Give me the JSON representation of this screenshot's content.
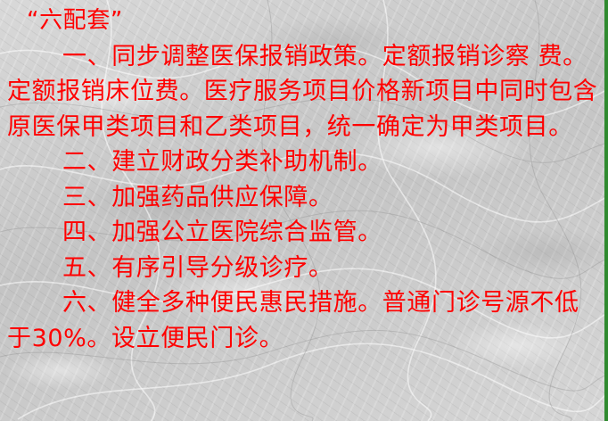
{
  "slide": {
    "title": "“六配套”",
    "paragraphs": [
      {
        "id": "item-1",
        "text": "一、同步调整医保报销政策。定额报销诊察 费。定额报销床位费。医疗服务项目价格新项目中同时包含原医保甲类项目和乙类项目，统一确定为甲类项目。"
      },
      {
        "id": "item-2",
        "text": "二、建立财政分类补助机制。"
      },
      {
        "id": "item-3",
        "text": "三、加强药品供应保障。"
      },
      {
        "id": "item-4",
        "text": "四、加强公立医院综合监管。"
      },
      {
        "id": "item-5",
        "text": "五、有序引导分级诊疗。"
      },
      {
        "id": "item-6",
        "text": "六、健全多种便民惠民措施。普通门诊号源不低于30%。设立便民门诊。"
      }
    ]
  },
  "colors": {
    "text": "#ff0000",
    "background": "#cfcfcf",
    "edge_strip": "#2f8a2f"
  }
}
